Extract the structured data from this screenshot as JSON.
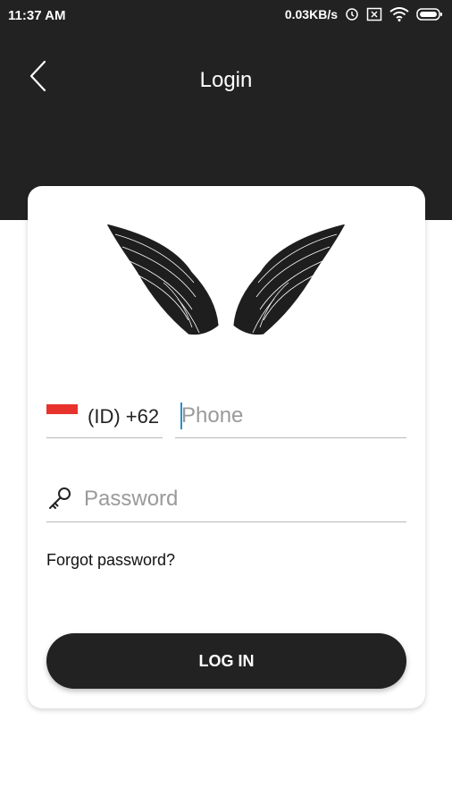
{
  "status_bar": {
    "time": "11:37 AM",
    "network_speed": "0.03KB/s",
    "icons": [
      "clock-icon",
      "no-sim-icon",
      "wifi-icon",
      "battery-icon"
    ]
  },
  "header": {
    "title": "Login",
    "back_icon": "chevron-left-icon"
  },
  "login_form": {
    "logo": "wings-logo",
    "country": {
      "code": "(ID) +62",
      "flag": "indonesia-flag"
    },
    "phone": {
      "placeholder": "Phone",
      "value": ""
    },
    "password": {
      "placeholder": "Password",
      "value": "",
      "icon": "key-icon"
    },
    "forgot_password": "Forgot password?",
    "submit_label": "LOG IN"
  },
  "colors": {
    "header_background": "#222222",
    "card_background": "#ffffff",
    "button_background": "#222222",
    "flag_red": "#e8332d",
    "caret": "#2a8ec9"
  }
}
